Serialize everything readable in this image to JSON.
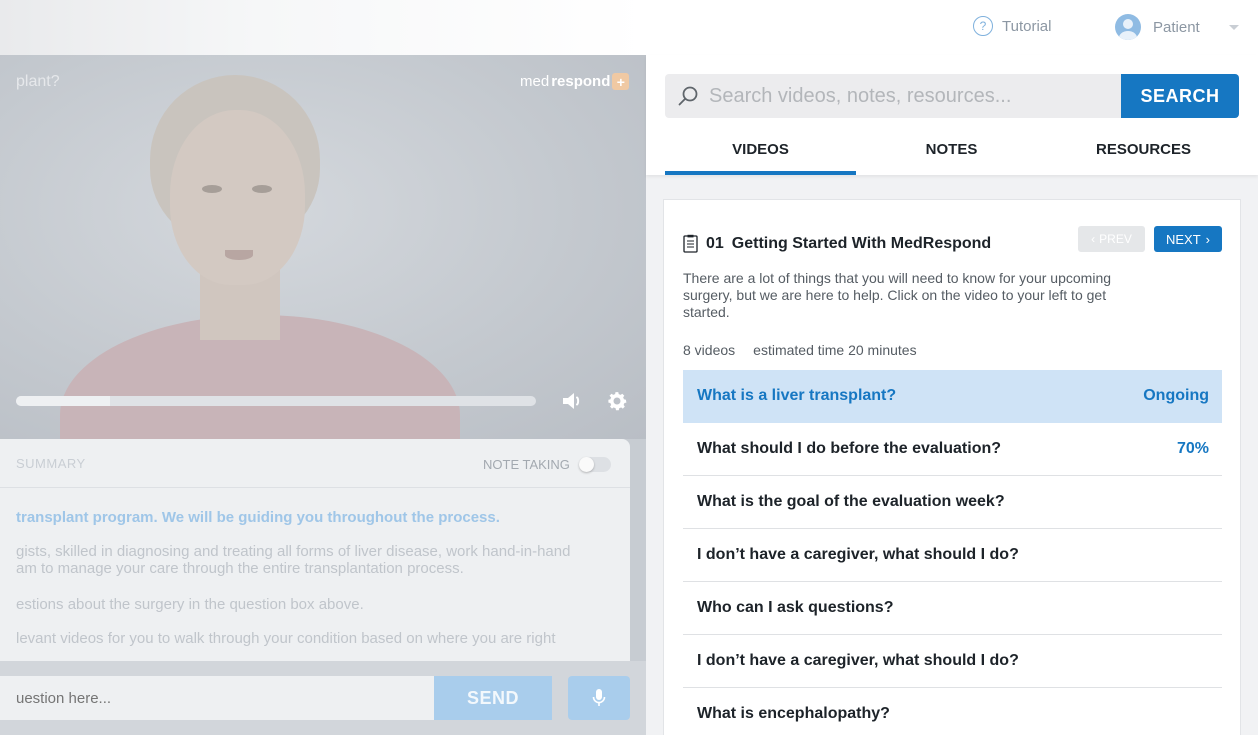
{
  "header": {
    "tutorial_label": "Tutorial",
    "user_label": "Patient"
  },
  "video": {
    "title_fragment": "plant?",
    "brand_prefix": "med",
    "brand_bold": "respond",
    "progress_fraction": 0.18
  },
  "summary": {
    "label": "SUMMARY",
    "note_taking_label": "NOTE TAKING",
    "lines": [
      "transplant program. We will be guiding you throughout the process.",
      "gists, skilled in diagnosing and treating all forms of liver disease, work hand-in-hand",
      "am to manage your care through the entire transplantation process.",
      "estions about the surgery in the question box above.",
      "levant videos for you to walk through your condition based on where you are right"
    ]
  },
  "composer": {
    "placeholder": "uestion here...",
    "send_label": "SEND"
  },
  "search": {
    "placeholder": "Search videos, notes, resources...",
    "button_label": "SEARCH"
  },
  "tabs": [
    {
      "label": "VIDEOS"
    },
    {
      "label": "NOTES"
    },
    {
      "label": "RESOURCES"
    }
  ],
  "section": {
    "number": "01",
    "title": "Getting Started With MedRespond",
    "prev_label": "PREV",
    "next_label": "NEXT",
    "description": "There are a lot of things that you will need to know for your upcoming surgery, but we are here to help. Click on the video to your left to get started.",
    "video_count": "8 videos",
    "estimated_time": "estimated time 20 minutes"
  },
  "videos": [
    {
      "title": "What is a liver transplant?",
      "status": "Ongoing"
    },
    {
      "title": "What should I do before the evaluation?",
      "status": "70%"
    },
    {
      "title": "What is the goal of the evaluation week?",
      "status": ""
    },
    {
      "title": "I don’t have a caregiver, what should I do?",
      "status": ""
    },
    {
      "title": "Who can I ask questions?",
      "status": ""
    },
    {
      "title": "I don’t have a caregiver, what should I do?",
      "status": ""
    },
    {
      "title": "What is encephalopathy?",
      "status": ""
    }
  ],
  "colors": {
    "accent": "#1677c2",
    "active_row": "#cfe3f6"
  }
}
